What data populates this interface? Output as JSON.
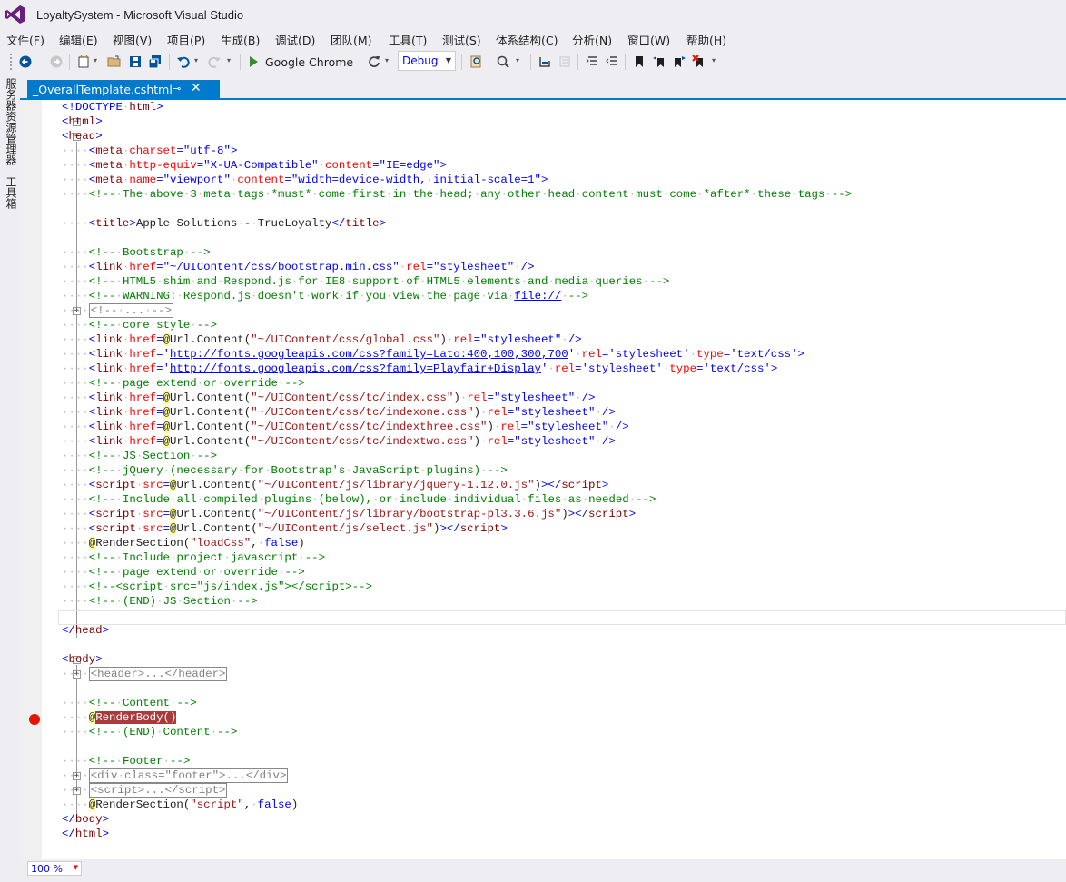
{
  "window": {
    "title": "LoyaltySystem - Microsoft Visual Studio"
  },
  "menu": [
    "文件(F)",
    "编辑(E)",
    "视图(V)",
    "项目(P)",
    "生成(B)",
    "调试(D)",
    "团队(M)",
    "工具(T)",
    "测试(S)",
    "体系结构(C)",
    "分析(N)",
    "窗口(W)",
    "帮助(H)"
  ],
  "toolbar": {
    "run_target": "Google Chrome",
    "configuration": "Debug"
  },
  "side_panels": [
    "服务器资源管理器",
    "工具箱"
  ],
  "editor_tab": {
    "filename": "_OverallTemplate.cshtml",
    "pin_icon": "pin-icon",
    "close_icon": "close-icon"
  },
  "zoom": "100 %",
  "code_lines": {
    "l1": "<!DOCTYPE html>",
    "l2": "<html>",
    "l3": "<head>",
    "title_line": "Apple Solutions - TrueLoyalty",
    "rb": "RenderBody()"
  }
}
